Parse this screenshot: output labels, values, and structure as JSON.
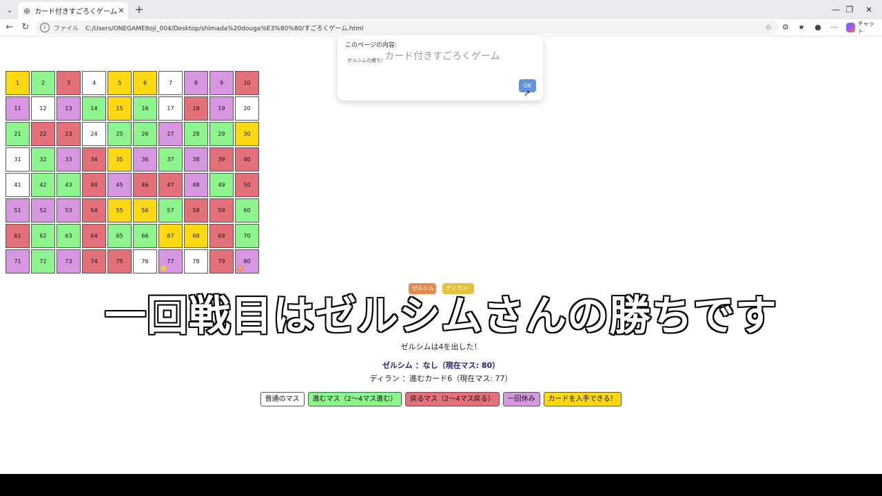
{
  "browser": {
    "tab_title": "カード付きすごろくゲーム",
    "tab_close": "✕",
    "new_tab": "+",
    "url_scheme": "ファイル",
    "url": "C:/Users/ONEGAME8oji_004/Desktop/shimada%20douga%E3%80%80/すごろくゲーム.html",
    "chat_label": "チャット"
  },
  "board": {
    "cells": [
      {
        "n": "1",
        "c": "y"
      },
      {
        "n": "2",
        "c": "g"
      },
      {
        "n": "3",
        "c": "r"
      },
      {
        "n": "4",
        "c": "w"
      },
      {
        "n": "5",
        "c": "y"
      },
      {
        "n": "6",
        "c": "y"
      },
      {
        "n": "7",
        "c": "w"
      },
      {
        "n": "8",
        "c": "p"
      },
      {
        "n": "9",
        "c": "p"
      },
      {
        "n": "10",
        "c": "r"
      },
      {
        "n": "11",
        "c": "p"
      },
      {
        "n": "12",
        "c": "w"
      },
      {
        "n": "13",
        "c": "p"
      },
      {
        "n": "14",
        "c": "g"
      },
      {
        "n": "15",
        "c": "y"
      },
      {
        "n": "16",
        "c": "g"
      },
      {
        "n": "17",
        "c": "w"
      },
      {
        "n": "18",
        "c": "r"
      },
      {
        "n": "19",
        "c": "p"
      },
      {
        "n": "20",
        "c": "w"
      },
      {
        "n": "21",
        "c": "g"
      },
      {
        "n": "22",
        "c": "r"
      },
      {
        "n": "23",
        "c": "r"
      },
      {
        "n": "24",
        "c": "w"
      },
      {
        "n": "25",
        "c": "g"
      },
      {
        "n": "26",
        "c": "g"
      },
      {
        "n": "27",
        "c": "p"
      },
      {
        "n": "28",
        "c": "g"
      },
      {
        "n": "29",
        "c": "g"
      },
      {
        "n": "30",
        "c": "y"
      },
      {
        "n": "31",
        "c": "w"
      },
      {
        "n": "32",
        "c": "g"
      },
      {
        "n": "33",
        "c": "p"
      },
      {
        "n": "34",
        "c": "r"
      },
      {
        "n": "35",
        "c": "y"
      },
      {
        "n": "36",
        "c": "p"
      },
      {
        "n": "37",
        "c": "g"
      },
      {
        "n": "38",
        "c": "p"
      },
      {
        "n": "39",
        "c": "r"
      },
      {
        "n": "40",
        "c": "r"
      },
      {
        "n": "41",
        "c": "w"
      },
      {
        "n": "42",
        "c": "g"
      },
      {
        "n": "43",
        "c": "g"
      },
      {
        "n": "44",
        "c": "r"
      },
      {
        "n": "45",
        "c": "p"
      },
      {
        "n": "46",
        "c": "r"
      },
      {
        "n": "47",
        "c": "r"
      },
      {
        "n": "48",
        "c": "p"
      },
      {
        "n": "49",
        "c": "g"
      },
      {
        "n": "50",
        "c": "r"
      },
      {
        "n": "51",
        "c": "p"
      },
      {
        "n": "52",
        "c": "p"
      },
      {
        "n": "53",
        "c": "p"
      },
      {
        "n": "54",
        "c": "r"
      },
      {
        "n": "55",
        "c": "y"
      },
      {
        "n": "56",
        "c": "y"
      },
      {
        "n": "57",
        "c": "g"
      },
      {
        "n": "58",
        "c": "r"
      },
      {
        "n": "59",
        "c": "r"
      },
      {
        "n": "60",
        "c": "g"
      },
      {
        "n": "61",
        "c": "r"
      },
      {
        "n": "62",
        "c": "g"
      },
      {
        "n": "63",
        "c": "g"
      },
      {
        "n": "64",
        "c": "r"
      },
      {
        "n": "65",
        "c": "g"
      },
      {
        "n": "66",
        "c": "g"
      },
      {
        "n": "67",
        "c": "y"
      },
      {
        "n": "68",
        "c": "y"
      },
      {
        "n": "69",
        "c": "r"
      },
      {
        "n": "70",
        "c": "g"
      },
      {
        "n": "71",
        "c": "p"
      },
      {
        "n": "72",
        "c": "g"
      },
      {
        "n": "73",
        "c": "p"
      },
      {
        "n": "74",
        "c": "r"
      },
      {
        "n": "75",
        "c": "r"
      },
      {
        "n": "76",
        "c": "w"
      },
      {
        "n": "77",
        "c": "p",
        "token": "デ",
        "tokenColor": "#e4c23a"
      },
      {
        "n": "78",
        "c": "w"
      },
      {
        "n": "79",
        "c": "r"
      },
      {
        "n": "80",
        "c": "p",
        "token": "ゼ",
        "tokenColor": "#e48a4f"
      }
    ]
  },
  "dialog": {
    "heading": "このページの内容:",
    "title": "カード付きすごろくゲーム",
    "message": "ゼルシムの勝ち！",
    "ok_label": "OK"
  },
  "players": {
    "chip_zelsim": "ゼルシム",
    "chip_dylan": "ディラン"
  },
  "caption": "一回戦目はゼルシムさんの勝ちです",
  "status": {
    "roll": "ゼルシムは4を出した！",
    "player1": "ゼルシム ：なし（現在マス: 80）",
    "player2": "ディラン ：進むカード6（現在マス: 77）"
  },
  "legend": [
    {
      "label": "普通のマス",
      "color": "#ffffff"
    },
    {
      "label": "進むマス（2〜4マス進む）",
      "color": "#8ef58e"
    },
    {
      "label": "戻るマス（2〜4マス戻る）",
      "color": "#e4707a"
    },
    {
      "label": "一回休み",
      "color": "#d796e0"
    },
    {
      "label": "カードを入手できる！",
      "color": "#ffd814"
    }
  ]
}
